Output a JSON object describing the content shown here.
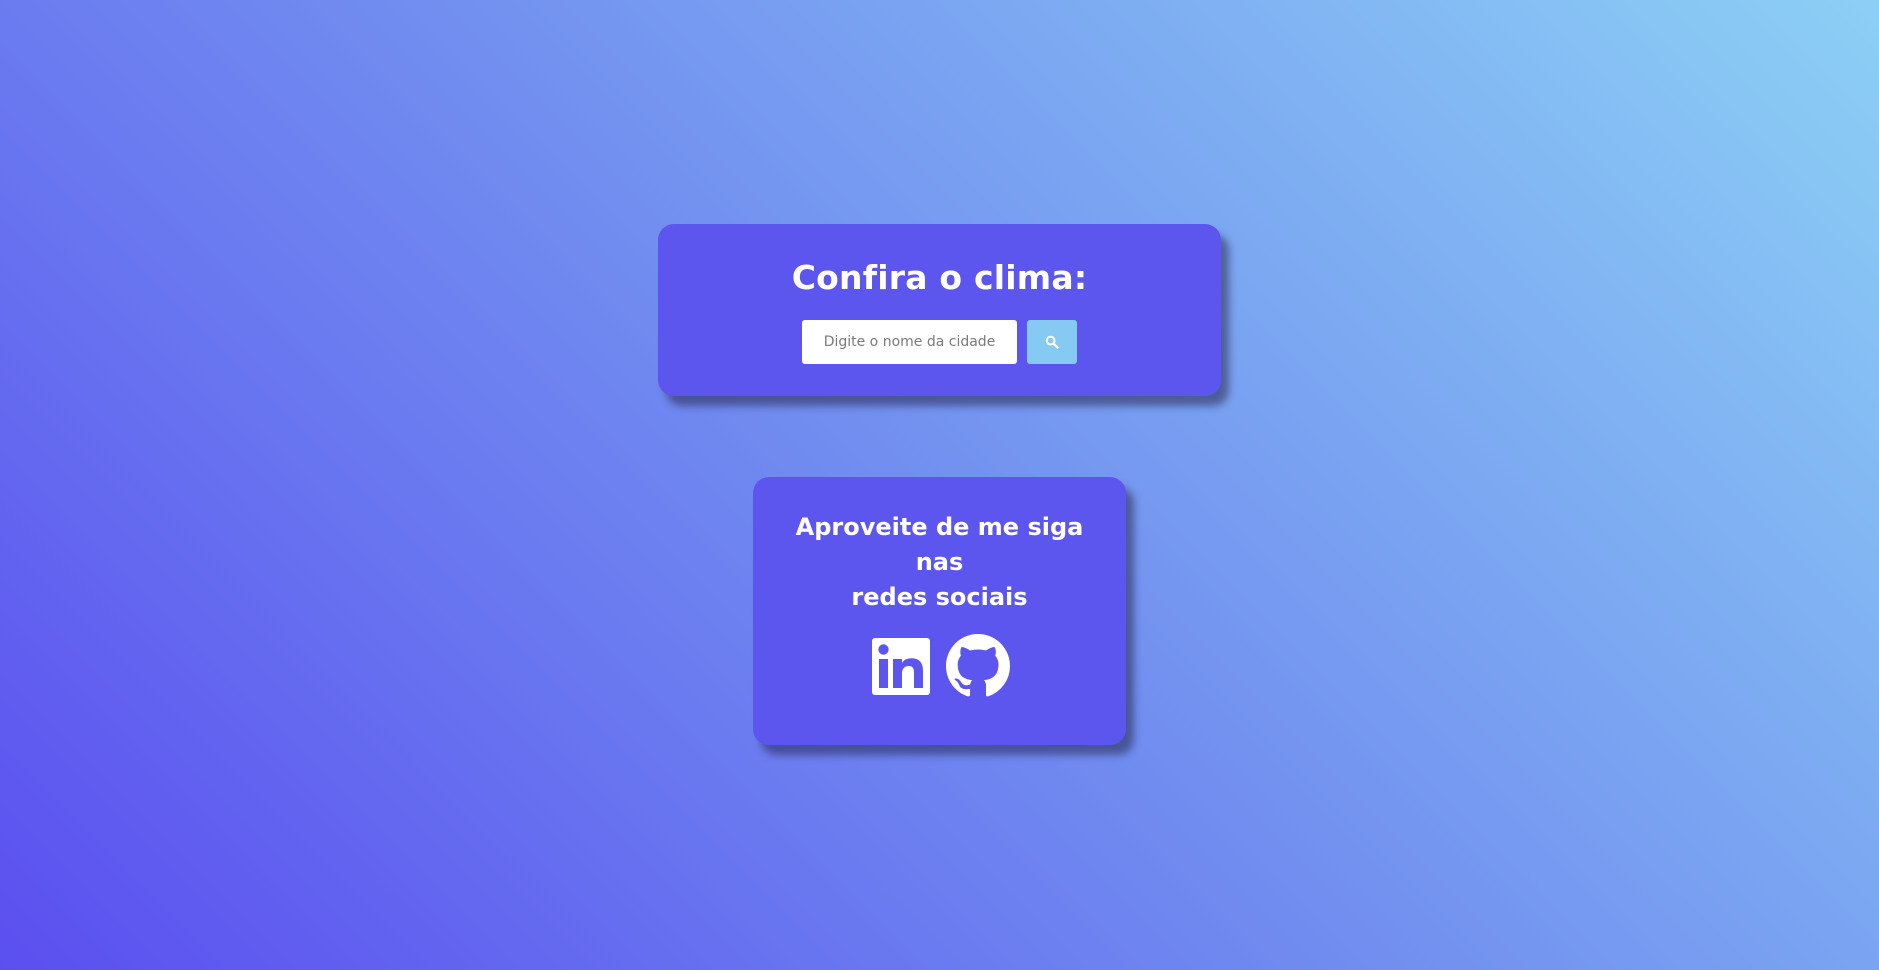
{
  "weather": {
    "title": "Confira o clima:",
    "search": {
      "placeholder": "Digite o nome da cidade",
      "value": "",
      "button_icon": "search-icon"
    }
  },
  "social": {
    "heading_line1": "Aproveite de me siga nas",
    "heading_line2": "redes sociais",
    "links": [
      {
        "icon": "linkedin-icon"
      },
      {
        "icon": "github-icon"
      }
    ]
  },
  "colors": {
    "card": "#5d56ee",
    "button": "#86c9f3",
    "text": "#ffffff",
    "gradient_start": "#5b4ff0",
    "gradient_end": "#8ccff5"
  }
}
